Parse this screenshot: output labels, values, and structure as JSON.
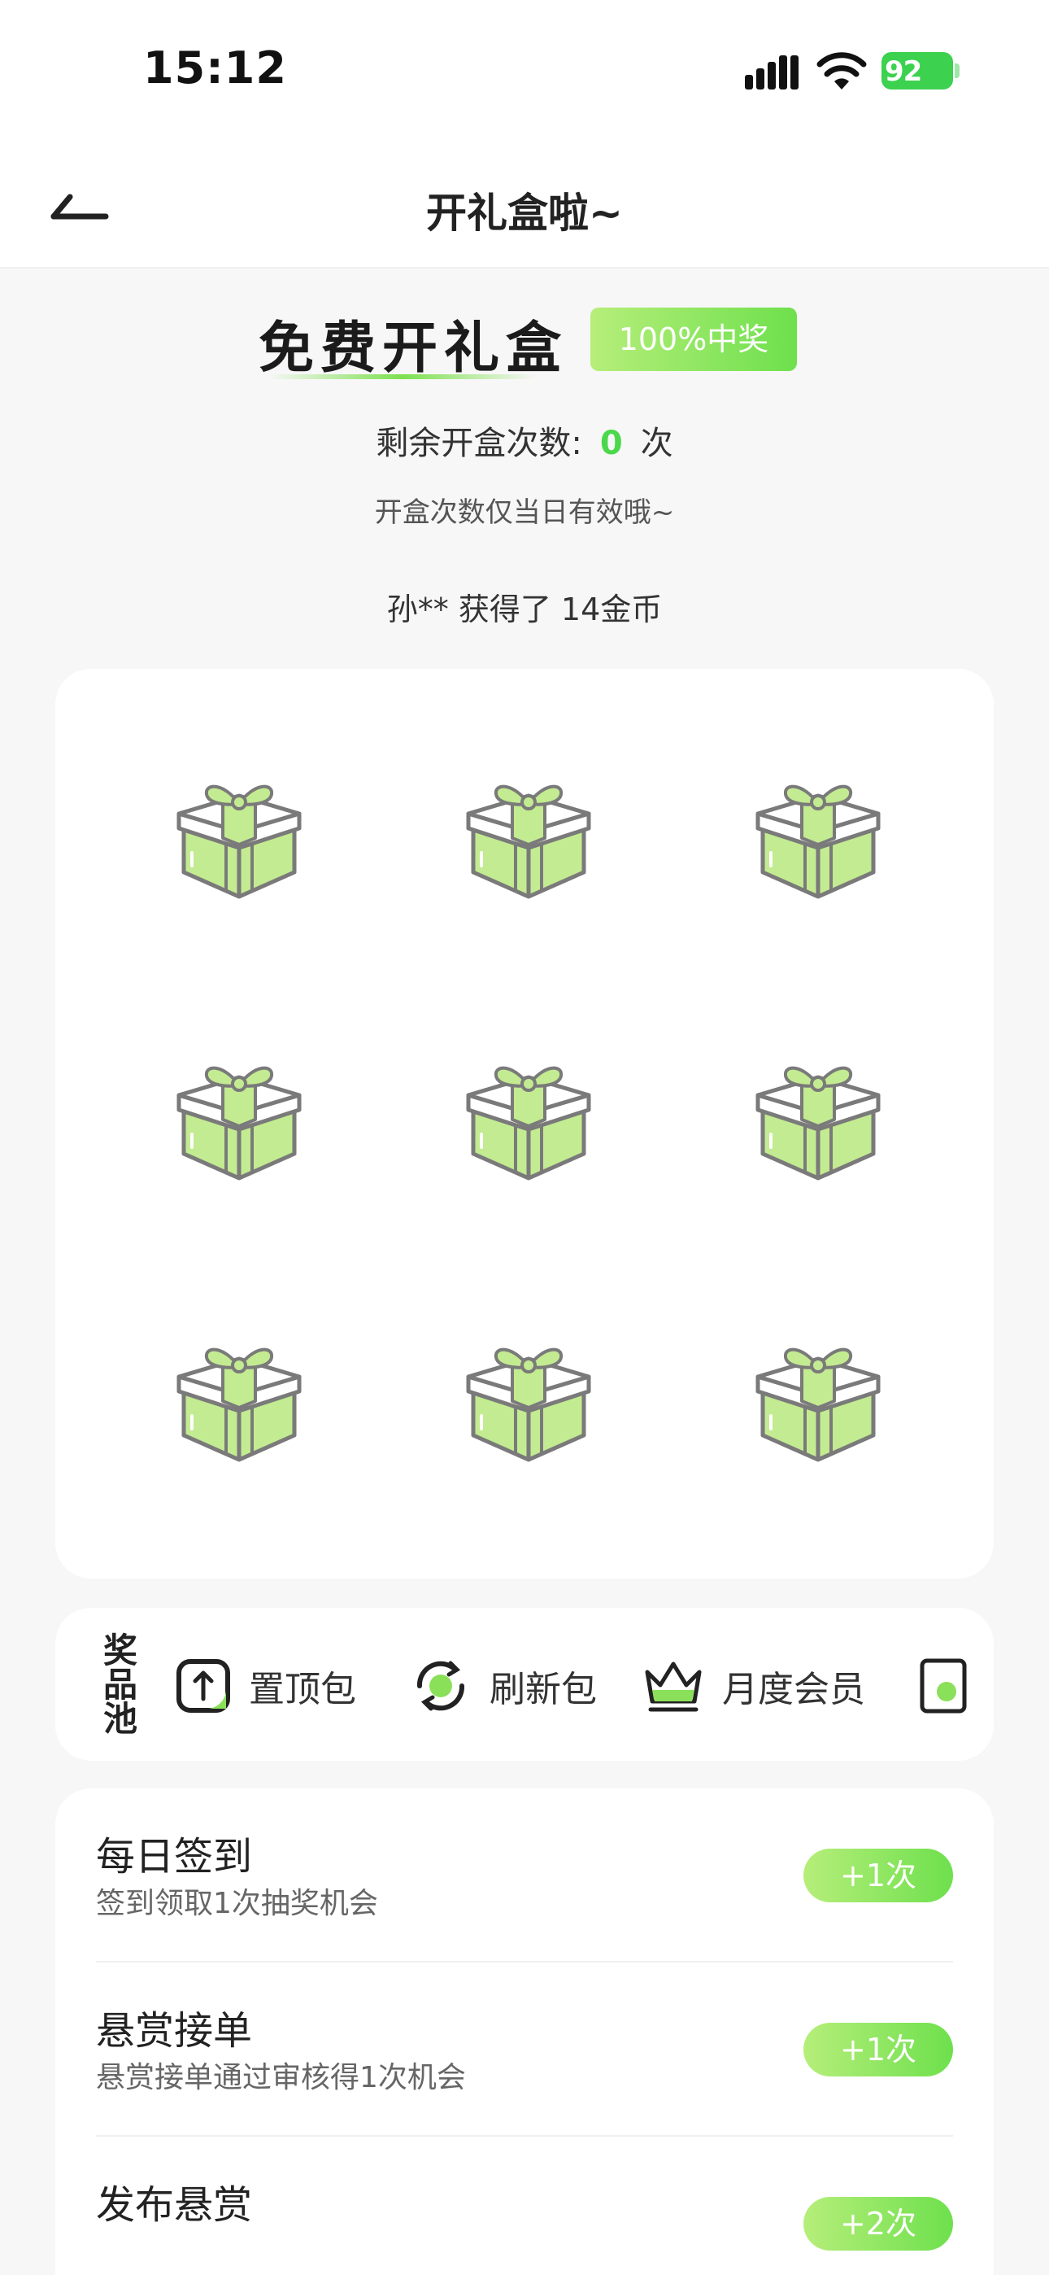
{
  "status_bar": {
    "time": "15:12",
    "battery": "92"
  },
  "nav": {
    "title": "开礼盒啦~"
  },
  "header": {
    "title": "免费开礼盒",
    "badge": "100%中奖",
    "remaining_label": "剩余开盒次数:",
    "remaining_count": "0",
    "remaining_unit": "次",
    "tip": "开盒次数仅当日有效哦~",
    "winner_notice": "孙** 获得了 14金币"
  },
  "gift_grid": {
    "count": 9,
    "icon": "gift-box-icon"
  },
  "prize_pool": {
    "label": "奖品池",
    "items": [
      {
        "label": "置顶包",
        "icon": "pin-top-icon"
      },
      {
        "label": "刷新包",
        "icon": "refresh-icon"
      },
      {
        "label": "月度会员",
        "icon": "crown-icon"
      },
      {
        "label": "",
        "icon": "card-icon"
      }
    ]
  },
  "tasks": [
    {
      "title": "每日签到",
      "desc": "签到领取1次抽奖机会",
      "button": "+1次"
    },
    {
      "title": "悬赏接单",
      "desc": "悬赏接单通过审核得1次机会",
      "button": "+1次"
    },
    {
      "title": "发布悬赏",
      "desc": "",
      "button": "+2次"
    }
  ],
  "colors": {
    "accent": "#6ee04d",
    "accent_light": "#b6ee7a",
    "gift_fill": "#c3eb91",
    "gift_stroke": "#7a7a7a"
  }
}
